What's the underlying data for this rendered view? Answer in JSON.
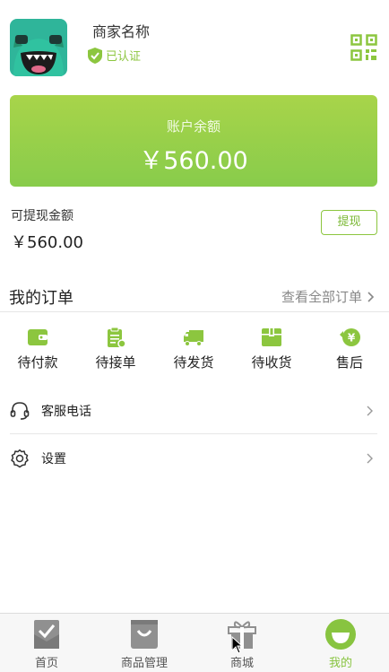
{
  "header": {
    "shop_name": "商家名称",
    "certified_label": "已认证",
    "avatar_icon": "monster-avatar",
    "qr_icon": "qr-code-icon",
    "accent_color": "#8cc63f"
  },
  "balance": {
    "label": "账户余额",
    "amount": "￥560.00"
  },
  "withdraw": {
    "label": "可提现金额",
    "amount": "￥560.00",
    "button_label": "提现"
  },
  "orders": {
    "title": "我的订单",
    "view_all": "查看全部订单",
    "items": [
      {
        "label": "待付款",
        "icon": "wallet-icon"
      },
      {
        "label": "待接单",
        "icon": "clipboard-icon"
      },
      {
        "label": "待发货",
        "icon": "truck-icon"
      },
      {
        "label": "待收货",
        "icon": "package-icon"
      },
      {
        "label": "售后",
        "icon": "yen-refund-icon"
      }
    ]
  },
  "menu": [
    {
      "label": "客服电话",
      "icon": "headset-icon"
    },
    {
      "label": "设置",
      "icon": "gear-icon"
    }
  ],
  "tabs": [
    {
      "label": "首页",
      "icon": "home-check-icon"
    },
    {
      "label": "商品管理",
      "icon": "shopping-bag-icon"
    },
    {
      "label": "商城",
      "icon": "gift-icon"
    },
    {
      "label": "我的",
      "icon": "smile-face-icon",
      "active": true
    }
  ]
}
